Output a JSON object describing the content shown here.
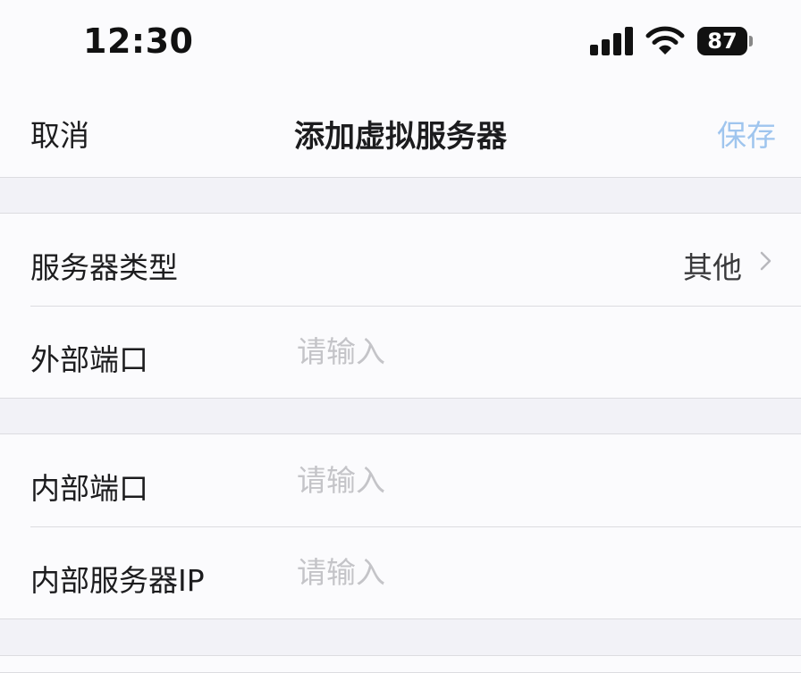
{
  "status_bar": {
    "time": "12:30",
    "battery": "87"
  },
  "nav": {
    "cancel": "取消",
    "title": "添加虚拟服务器",
    "save": "保存"
  },
  "groups": [
    {
      "rows": [
        {
          "label": "服务器类型",
          "value": "其他"
        },
        {
          "label": "外部端口",
          "placeholder": "请输入"
        }
      ]
    },
    {
      "rows": [
        {
          "label": "内部端口",
          "placeholder": "请输入"
        },
        {
          "label": "内部服务器IP",
          "placeholder": "请输入"
        }
      ]
    }
  ],
  "colors": {
    "background": "#f2f2f7",
    "cell": "#fbfbfd",
    "save_disabled": "#9fc5ee",
    "placeholder": "#c4c4c8",
    "separator": "#dcdce0"
  },
  "icons": [
    "cellular-signal-icon",
    "wifi-icon",
    "battery-icon",
    "chevron-right-icon"
  ]
}
